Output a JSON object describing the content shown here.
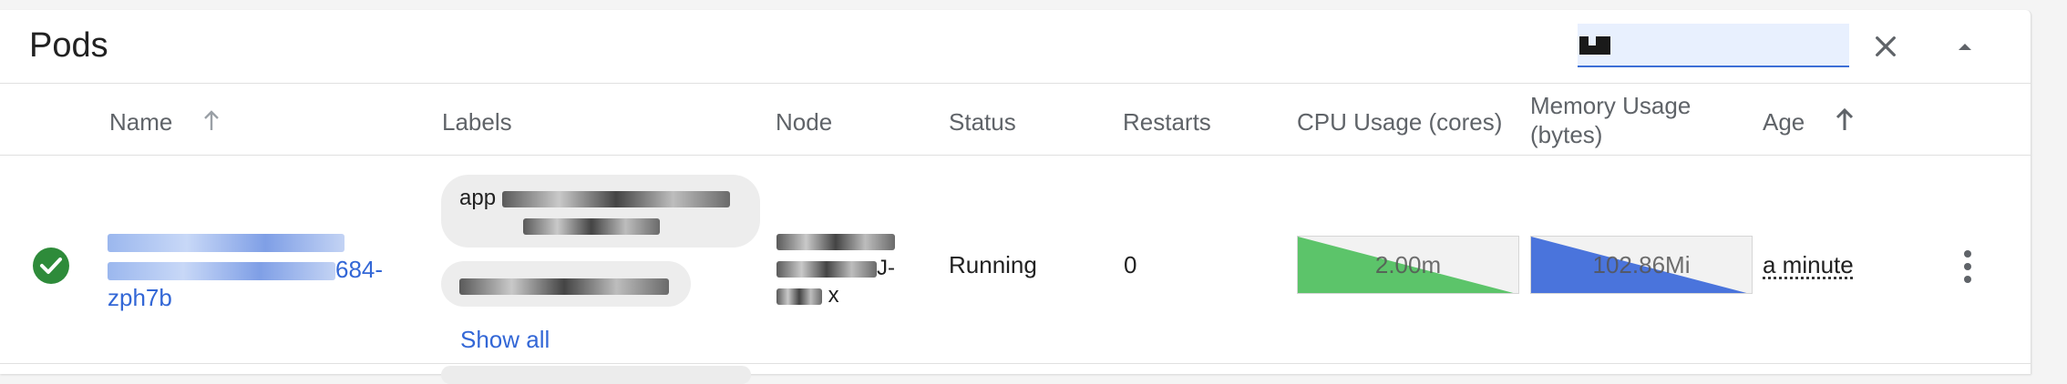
{
  "panel": {
    "title": "Pods",
    "filter": {
      "value": "",
      "placeholder": ""
    }
  },
  "columns": [
    {
      "key": "name",
      "label": "Name",
      "sortable": true,
      "sort": "asc"
    },
    {
      "key": "labels",
      "label": "Labels"
    },
    {
      "key": "node",
      "label": "Node"
    },
    {
      "key": "status",
      "label": "Status"
    },
    {
      "key": "restarts",
      "label": "Restarts"
    },
    {
      "key": "cpu",
      "label": "CPU Usage (cores)"
    },
    {
      "key": "memory",
      "label": "Memory Usage (bytes)"
    },
    {
      "key": "age",
      "label": "Age",
      "sortable": true,
      "sort": "asc"
    }
  ],
  "rows": [
    {
      "status_icon": "check-circle-icon",
      "name_suffix": "684-",
      "name_suffix2": "zph7b",
      "labels_first_prefix": "app",
      "show_all": "Show all",
      "node_suffix": "J-",
      "node_suffix2": "x",
      "status": "Running",
      "restarts": "0",
      "cpu": "2.00m",
      "memory": "102.86Mi",
      "age": "a minute"
    }
  ],
  "colors": {
    "accent": "#3367d6",
    "cpu_fill": "#5cc46a",
    "memory_fill": "#4a74dc",
    "status_ok": "#2e8b3a"
  }
}
